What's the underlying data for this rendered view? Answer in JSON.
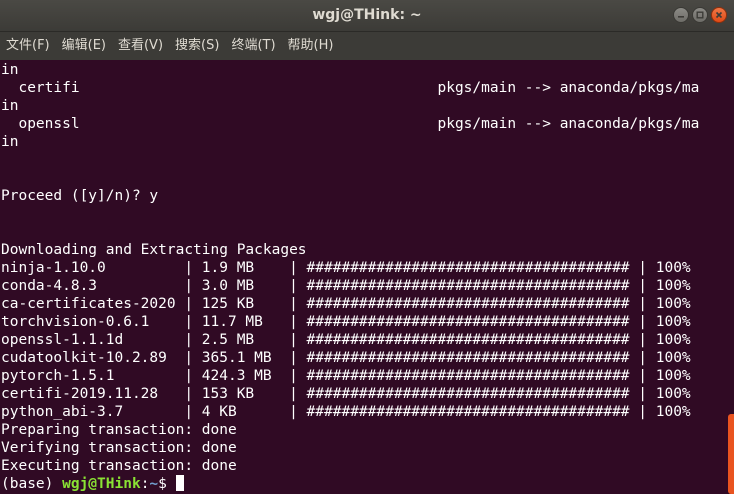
{
  "window": {
    "title": "wgj@THink: ~"
  },
  "menu": [
    "文件(F)",
    "编辑(E)",
    "查看(V)",
    "搜索(S)",
    "终端(T)",
    "帮助(H)"
  ],
  "terminal": {
    "lines": [
      "in",
      "  certifi                                         pkgs/main --> anaconda/pkgs/ma",
      "in",
      "  openssl                                         pkgs/main --> anaconda/pkgs/ma",
      "in",
      "",
      "",
      "Proceed ([y]/n)? y",
      "",
      "",
      "Downloading and Extracting Packages",
      "ninja-1.10.0         | 1.9 MB    | ##################################### | 100%",
      "conda-4.8.3          | 3.0 MB    | ##################################### | 100%",
      "ca-certificates-2020 | 125 KB    | ##################################### | 100%",
      "torchvision-0.6.1    | 11.7 MB   | ##################################### | 100%",
      "openssl-1.1.1d       | 2.5 MB    | ##################################### | 100%",
      "cudatoolkit-10.2.89  | 365.1 MB  | ##################################### | 100%",
      "pytorch-1.5.1        | 424.3 MB  | ##################################### | 100%",
      "certifi-2019.11.28   | 153 KB    | ##################################### | 100%",
      "python_abi-3.7       | 4 KB      | ##################################### | 100%",
      "Preparing transaction: done",
      "Verifying transaction: done",
      "Executing transaction: done"
    ],
    "prompt": {
      "env": "(base) ",
      "user_host": "wgj@THink",
      "sep": ":",
      "path": "~",
      "symbol": "$ "
    }
  }
}
